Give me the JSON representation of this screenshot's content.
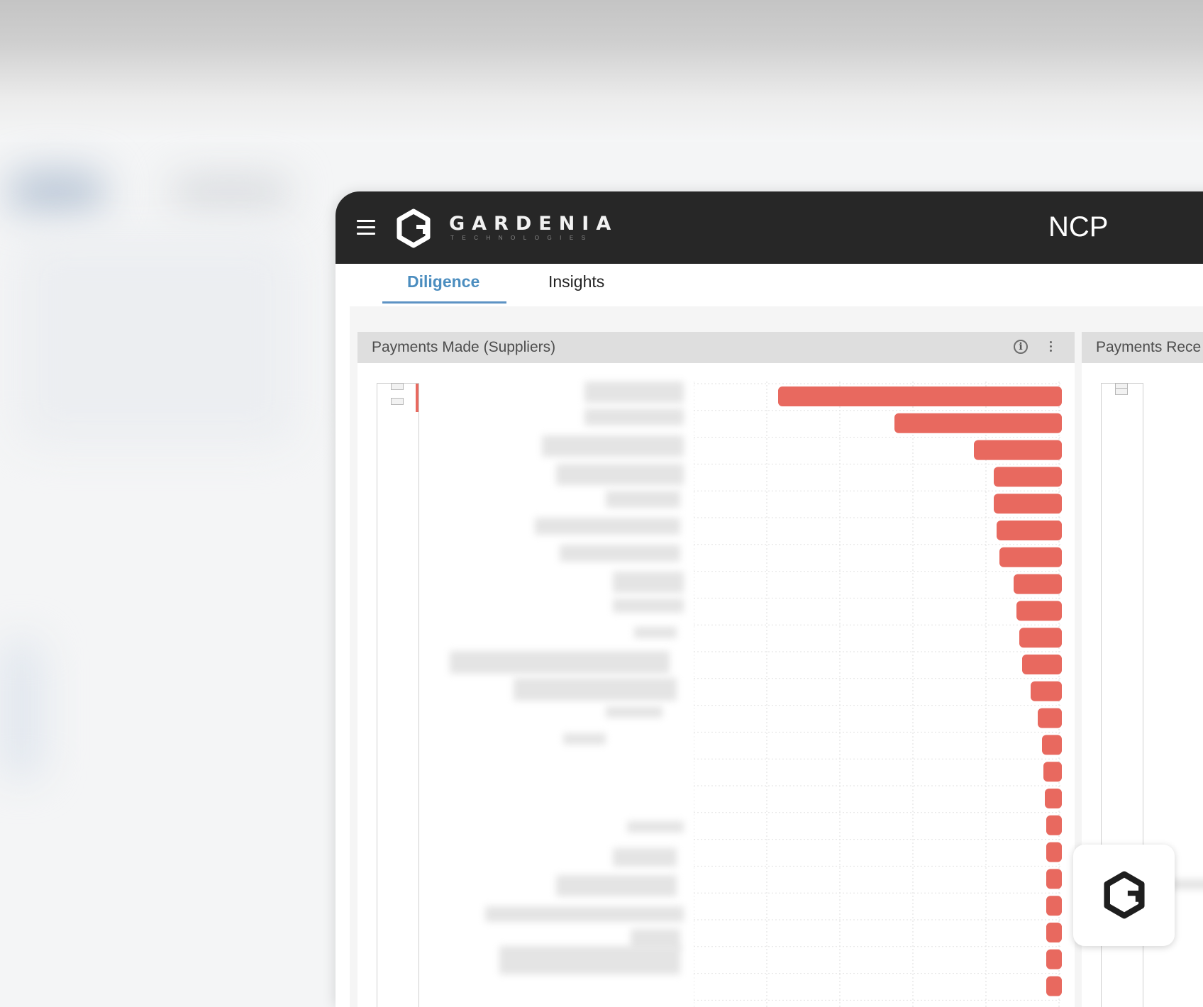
{
  "brand": {
    "name": "GARDENIA",
    "subtitle": "TECHNOLOGIES"
  },
  "header": {
    "title": "NCP"
  },
  "tabs": [
    {
      "label": "Diligence",
      "active": true
    },
    {
      "label": "Insights",
      "active": false
    }
  ],
  "panels": {
    "suppliers": {
      "title": "Payments Made (Suppliers)"
    },
    "receipts": {
      "title": "Payments Rece"
    }
  },
  "colors": {
    "bar": "#e8695f",
    "accent": "#4b8dbf",
    "topbar": "#272727"
  },
  "icons": [
    "menu-icon",
    "gardenia-logo-icon",
    "info-icon",
    "more-vertical-icon"
  ],
  "chart_data": {
    "type": "bar",
    "orientation": "horizontal",
    "values": [
      100,
      59,
      31,
      24,
      24,
      23,
      22,
      17,
      16,
      15,
      14,
      11,
      8.5,
      7,
      6.5,
      6,
      5.5,
      5,
      4.5,
      4.3,
      4,
      3.8,
      3.6
    ],
    "categories_visible": false,
    "grid": true
  }
}
